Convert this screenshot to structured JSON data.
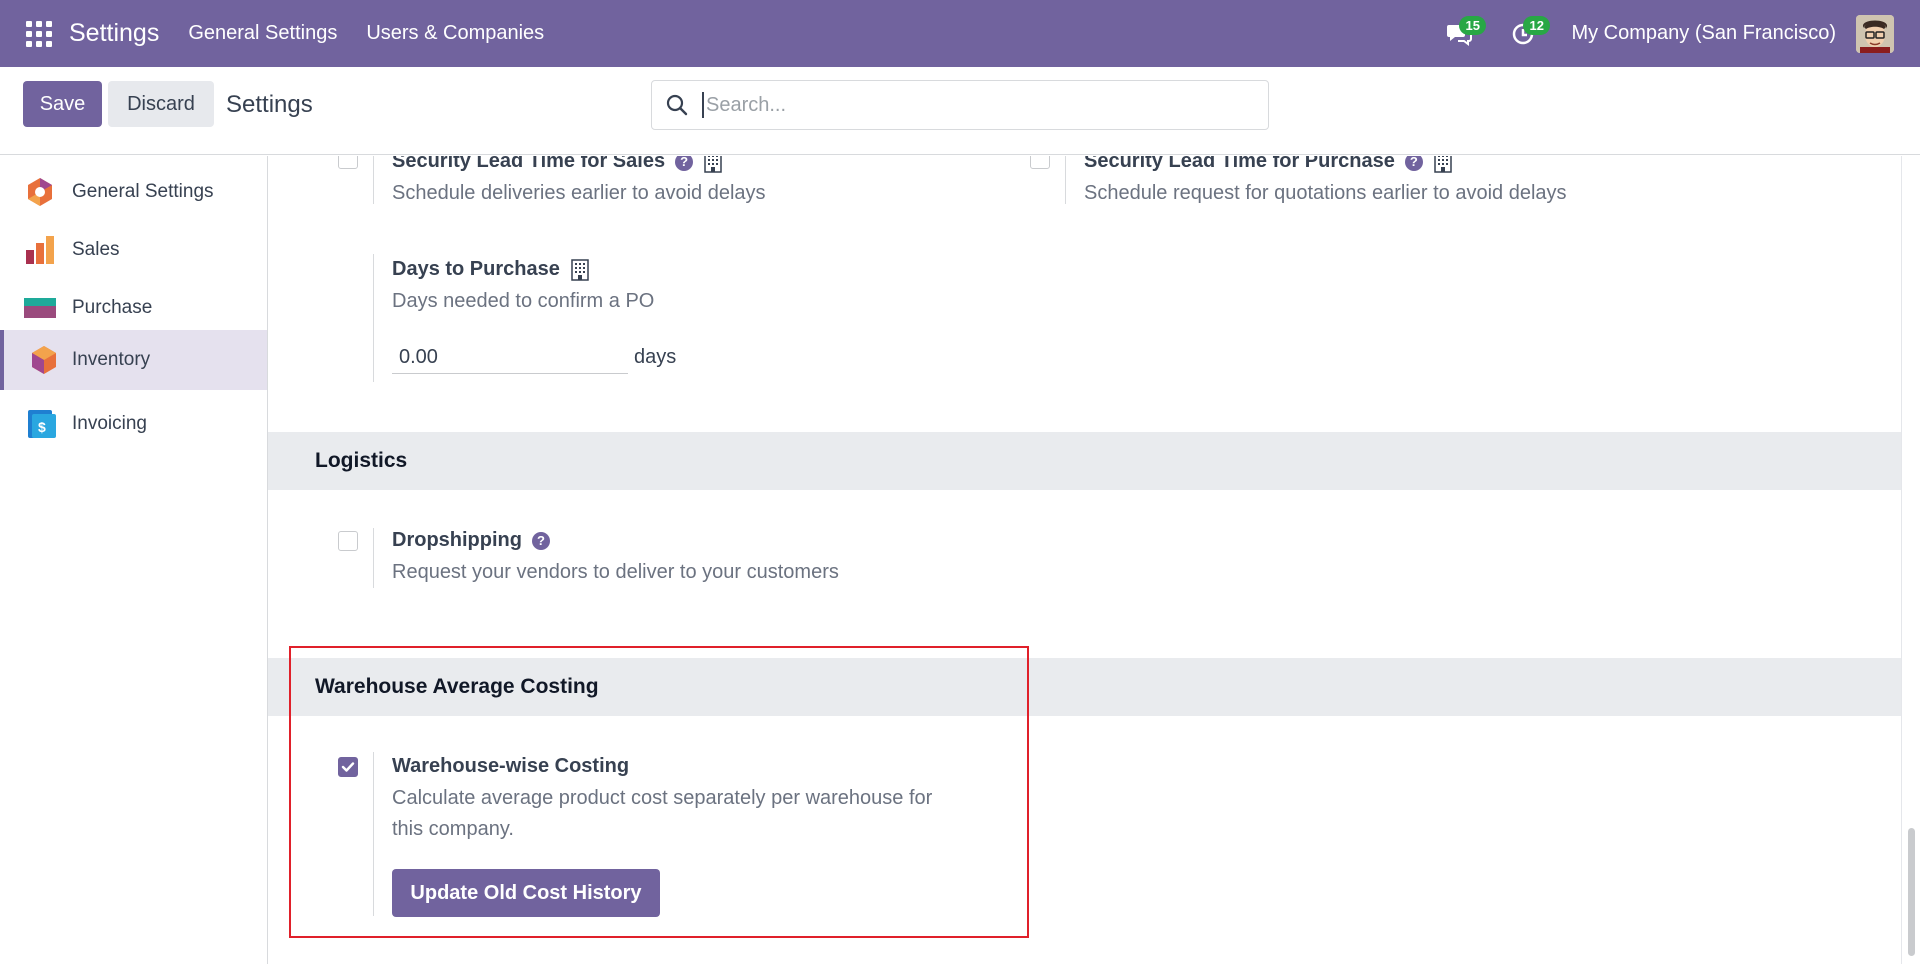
{
  "topnav": {
    "app_title": "Settings",
    "menus": [
      "General Settings",
      "Users & Companies"
    ],
    "messages_count": "15",
    "activities_count": "12",
    "company": "My Company (San Francisco)"
  },
  "control": {
    "save_label": "Save",
    "discard_label": "Discard",
    "breadcrumb": "Settings",
    "search_placeholder": "Search..."
  },
  "sidebar": {
    "items": [
      {
        "label": "General Settings",
        "icon": "general-settings-icon"
      },
      {
        "label": "Sales",
        "icon": "sales-icon"
      },
      {
        "label": "Purchase",
        "icon": "purchase-icon"
      },
      {
        "label": "Inventory",
        "icon": "inventory-icon",
        "active": true
      },
      {
        "label": "Invoicing",
        "icon": "invoicing-icon"
      }
    ]
  },
  "settings": {
    "lead_sales": {
      "title": "Security Lead Time for Sales",
      "desc": "Schedule deliveries earlier to avoid delays",
      "checked": false
    },
    "lead_purchase": {
      "title": "Security Lead Time for Purchase",
      "desc": "Schedule request for quotations earlier to avoid delays",
      "checked": false
    },
    "days_to_purchase": {
      "title": "Days to Purchase",
      "desc": "Days needed to confirm a PO",
      "value": "0.00",
      "unit": "days"
    },
    "logistics": {
      "heading": "Logistics"
    },
    "dropshipping": {
      "title": "Dropshipping",
      "desc": "Request your vendors to deliver to your customers",
      "checked": false
    },
    "warehouse": {
      "heading": "Warehouse Average Costing"
    },
    "warehouse_costing": {
      "title": "Warehouse-wise Costing",
      "desc_line1": "Calculate average product cost separately per warehouse for",
      "desc_line2": "this company.",
      "checked": true,
      "button": "Update Old Cost History"
    }
  },
  "colors": {
    "brand": "#71639e",
    "highlight": "#e0202a",
    "badge": "#28a745"
  }
}
